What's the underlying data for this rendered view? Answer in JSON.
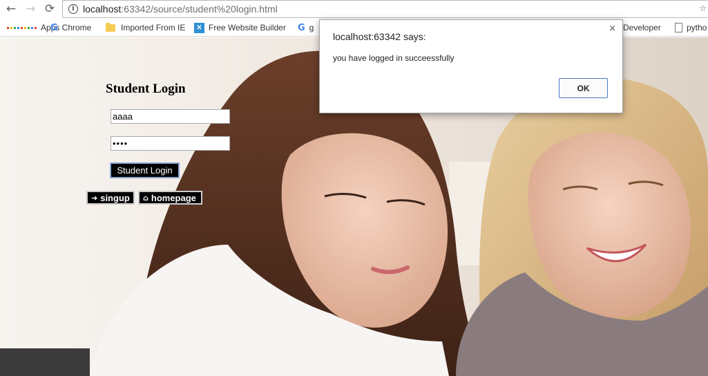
{
  "browser": {
    "url_host": "localhost",
    "url_rest": ":63342/source/student%20login.html",
    "bookmarks": {
      "apps": "Apps",
      "chrome": "Chrome",
      "imported": "Imported From IE",
      "fwb": "Free Website Builder",
      "g_partial": "g",
      "developer": "Developer",
      "python_partial": "pytho"
    },
    "colors": {
      "apps_grid": [
        "#ea4335",
        "#fbbc05",
        "#34a853",
        "#4285f4",
        "#ea4335",
        "#fbbc05",
        "#34a853",
        "#4285f4",
        "#ea4335"
      ]
    }
  },
  "page": {
    "title": "Student Login",
    "username_value": "aaaa",
    "password_value": "••••",
    "login_button": "Student Login",
    "signup_button": "singup",
    "homepage_button": "homepage"
  },
  "alert": {
    "title": "localhost:63342 says:",
    "message": "you have logged in succeessfully",
    "ok_label": "OK",
    "close_glyph": "×"
  },
  "icons": {
    "back": "←",
    "forward": "→",
    "reload": "⟳",
    "signin": "➜",
    "home": "⌂"
  }
}
